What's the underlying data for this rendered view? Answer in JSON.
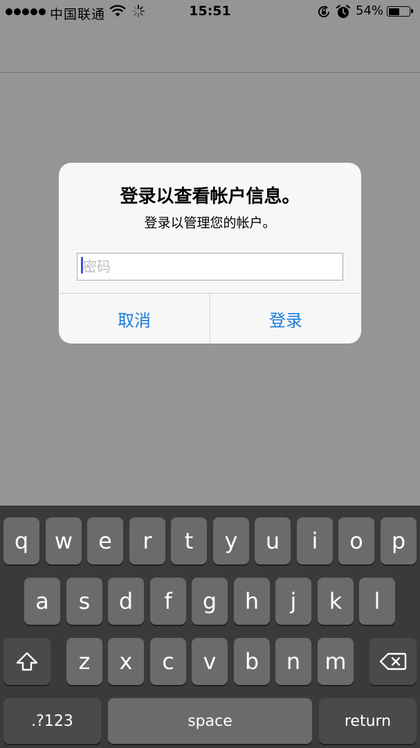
{
  "status_bar": {
    "carrier": "中国联通",
    "time": "15:51",
    "battery_percent": "54%",
    "battery_level": 0.54,
    "icons": [
      "signal-dots",
      "wifi-icon",
      "activity-spinner-icon",
      "rotation-lock-icon",
      "alarm-icon",
      "battery-icon"
    ]
  },
  "alert": {
    "title": "登录以查看帐户信息。",
    "message": "登录以管理您的帐户。",
    "password_placeholder": "密码",
    "password_value": "",
    "cancel_label": "取消",
    "confirm_label": "登录"
  },
  "keyboard": {
    "row1": [
      "q",
      "w",
      "e",
      "r",
      "t",
      "y",
      "u",
      "i",
      "o",
      "p"
    ],
    "row2": [
      "a",
      "s",
      "d",
      "f",
      "g",
      "h",
      "j",
      "k",
      "l"
    ],
    "row3": [
      "z",
      "x",
      "c",
      "v",
      "b",
      "n",
      "m"
    ],
    "numbers_label": ".?123",
    "space_label": "space",
    "return_label": "return",
    "shift_icon": "shift-icon",
    "delete_icon": "delete-backspace-icon"
  },
  "colors": {
    "dimmed_background": "#959595",
    "alert_background": "#f7f7f7",
    "button_text": "#1a7cdb",
    "keyboard_background": "#3a3a3a",
    "key_background": "#6b6b6b"
  }
}
